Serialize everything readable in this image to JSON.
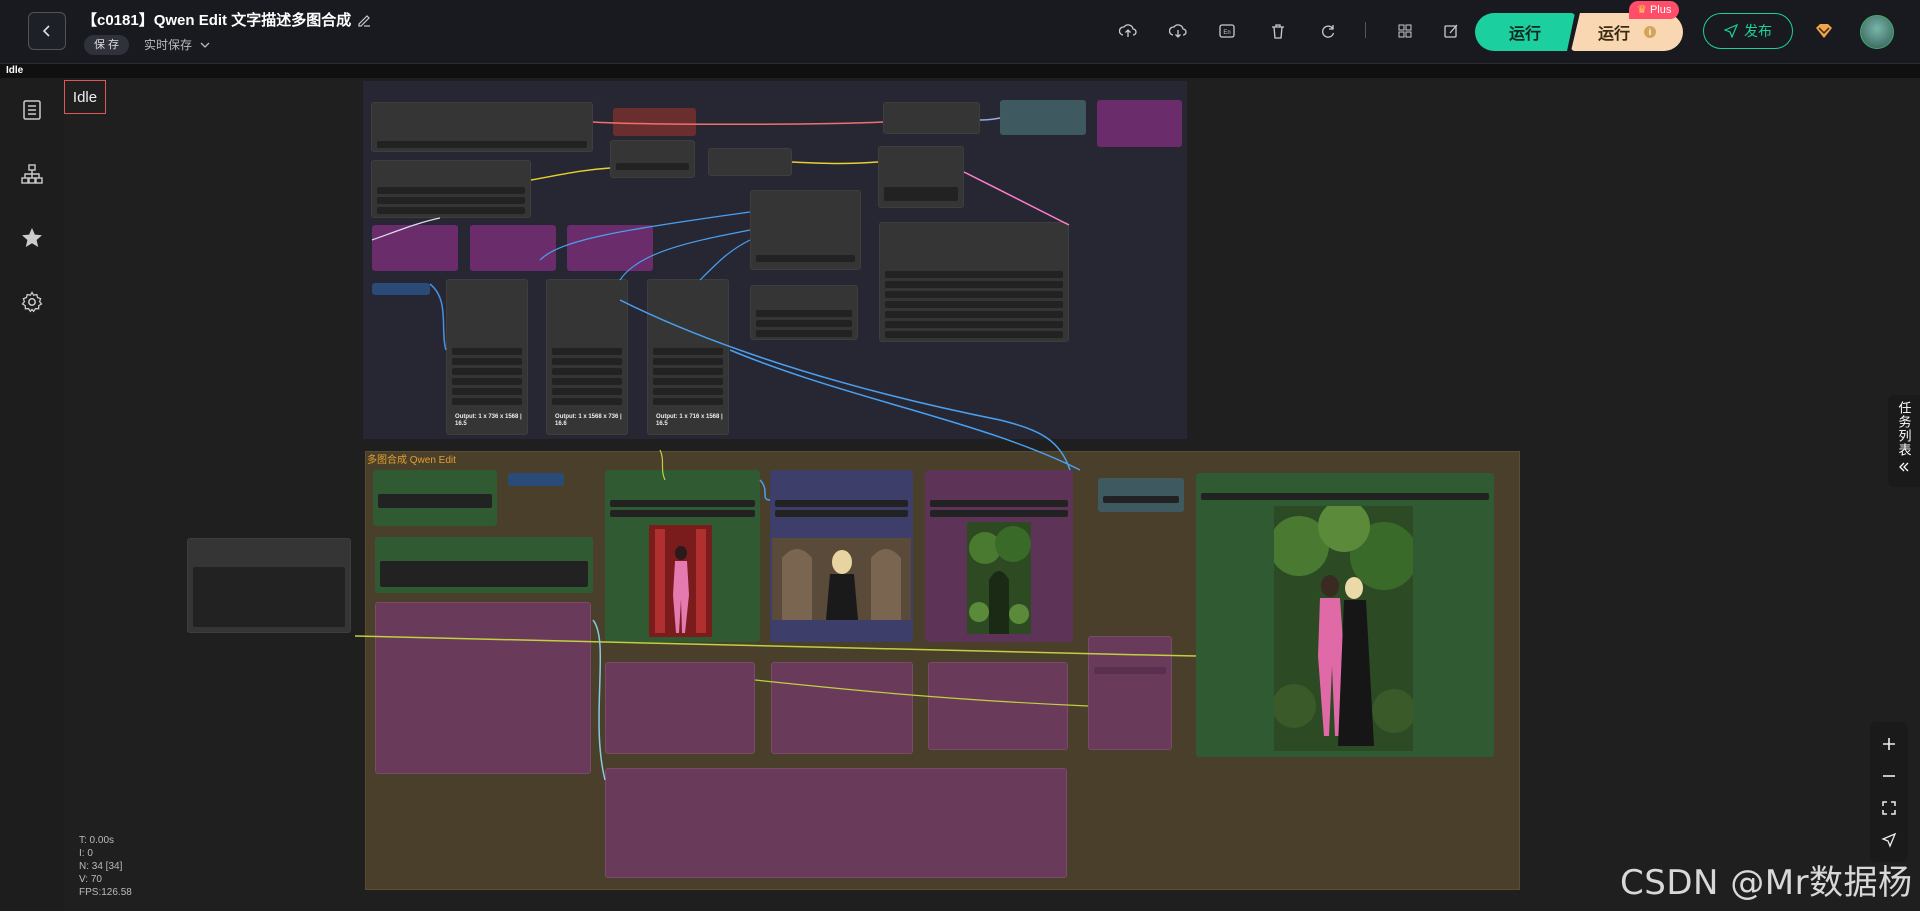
{
  "header": {
    "title": "【c0181】Qwen Edit 文字描述多图合成",
    "save_label": "保 存",
    "autosave_label": "实时保存",
    "run_label": "运行",
    "run_plus_label": "运行",
    "plus_badge": "Plus",
    "publish_label": "发布"
  },
  "subbar": {
    "status": "Idle"
  },
  "canvas": {
    "idle_label": "Idle",
    "group_lower_title": "多图合成 Qwen Edit",
    "output_text_1": "Output: 1 x 736 x 1568 | 16.5",
    "output_text_2": "Output: 1 x 1568 x 736 | 16.6",
    "output_text_3": "Output: 1 x 716 x 1568 | 16.5",
    "stats": {
      "t": "T: 0.00s",
      "i": "I: 0",
      "n": "N: 34 [34]",
      "v": "V: 70",
      "fps": "FPS:126.58"
    }
  },
  "right_panel": {
    "task_list_label": "任务列表"
  },
  "watermark": "CSDN @Mr数据杨",
  "colors": {
    "accent": "#1ccf9e",
    "plus": "#f8d7b2",
    "badge": "#ff4d6a",
    "idle_border": "#e05555"
  }
}
